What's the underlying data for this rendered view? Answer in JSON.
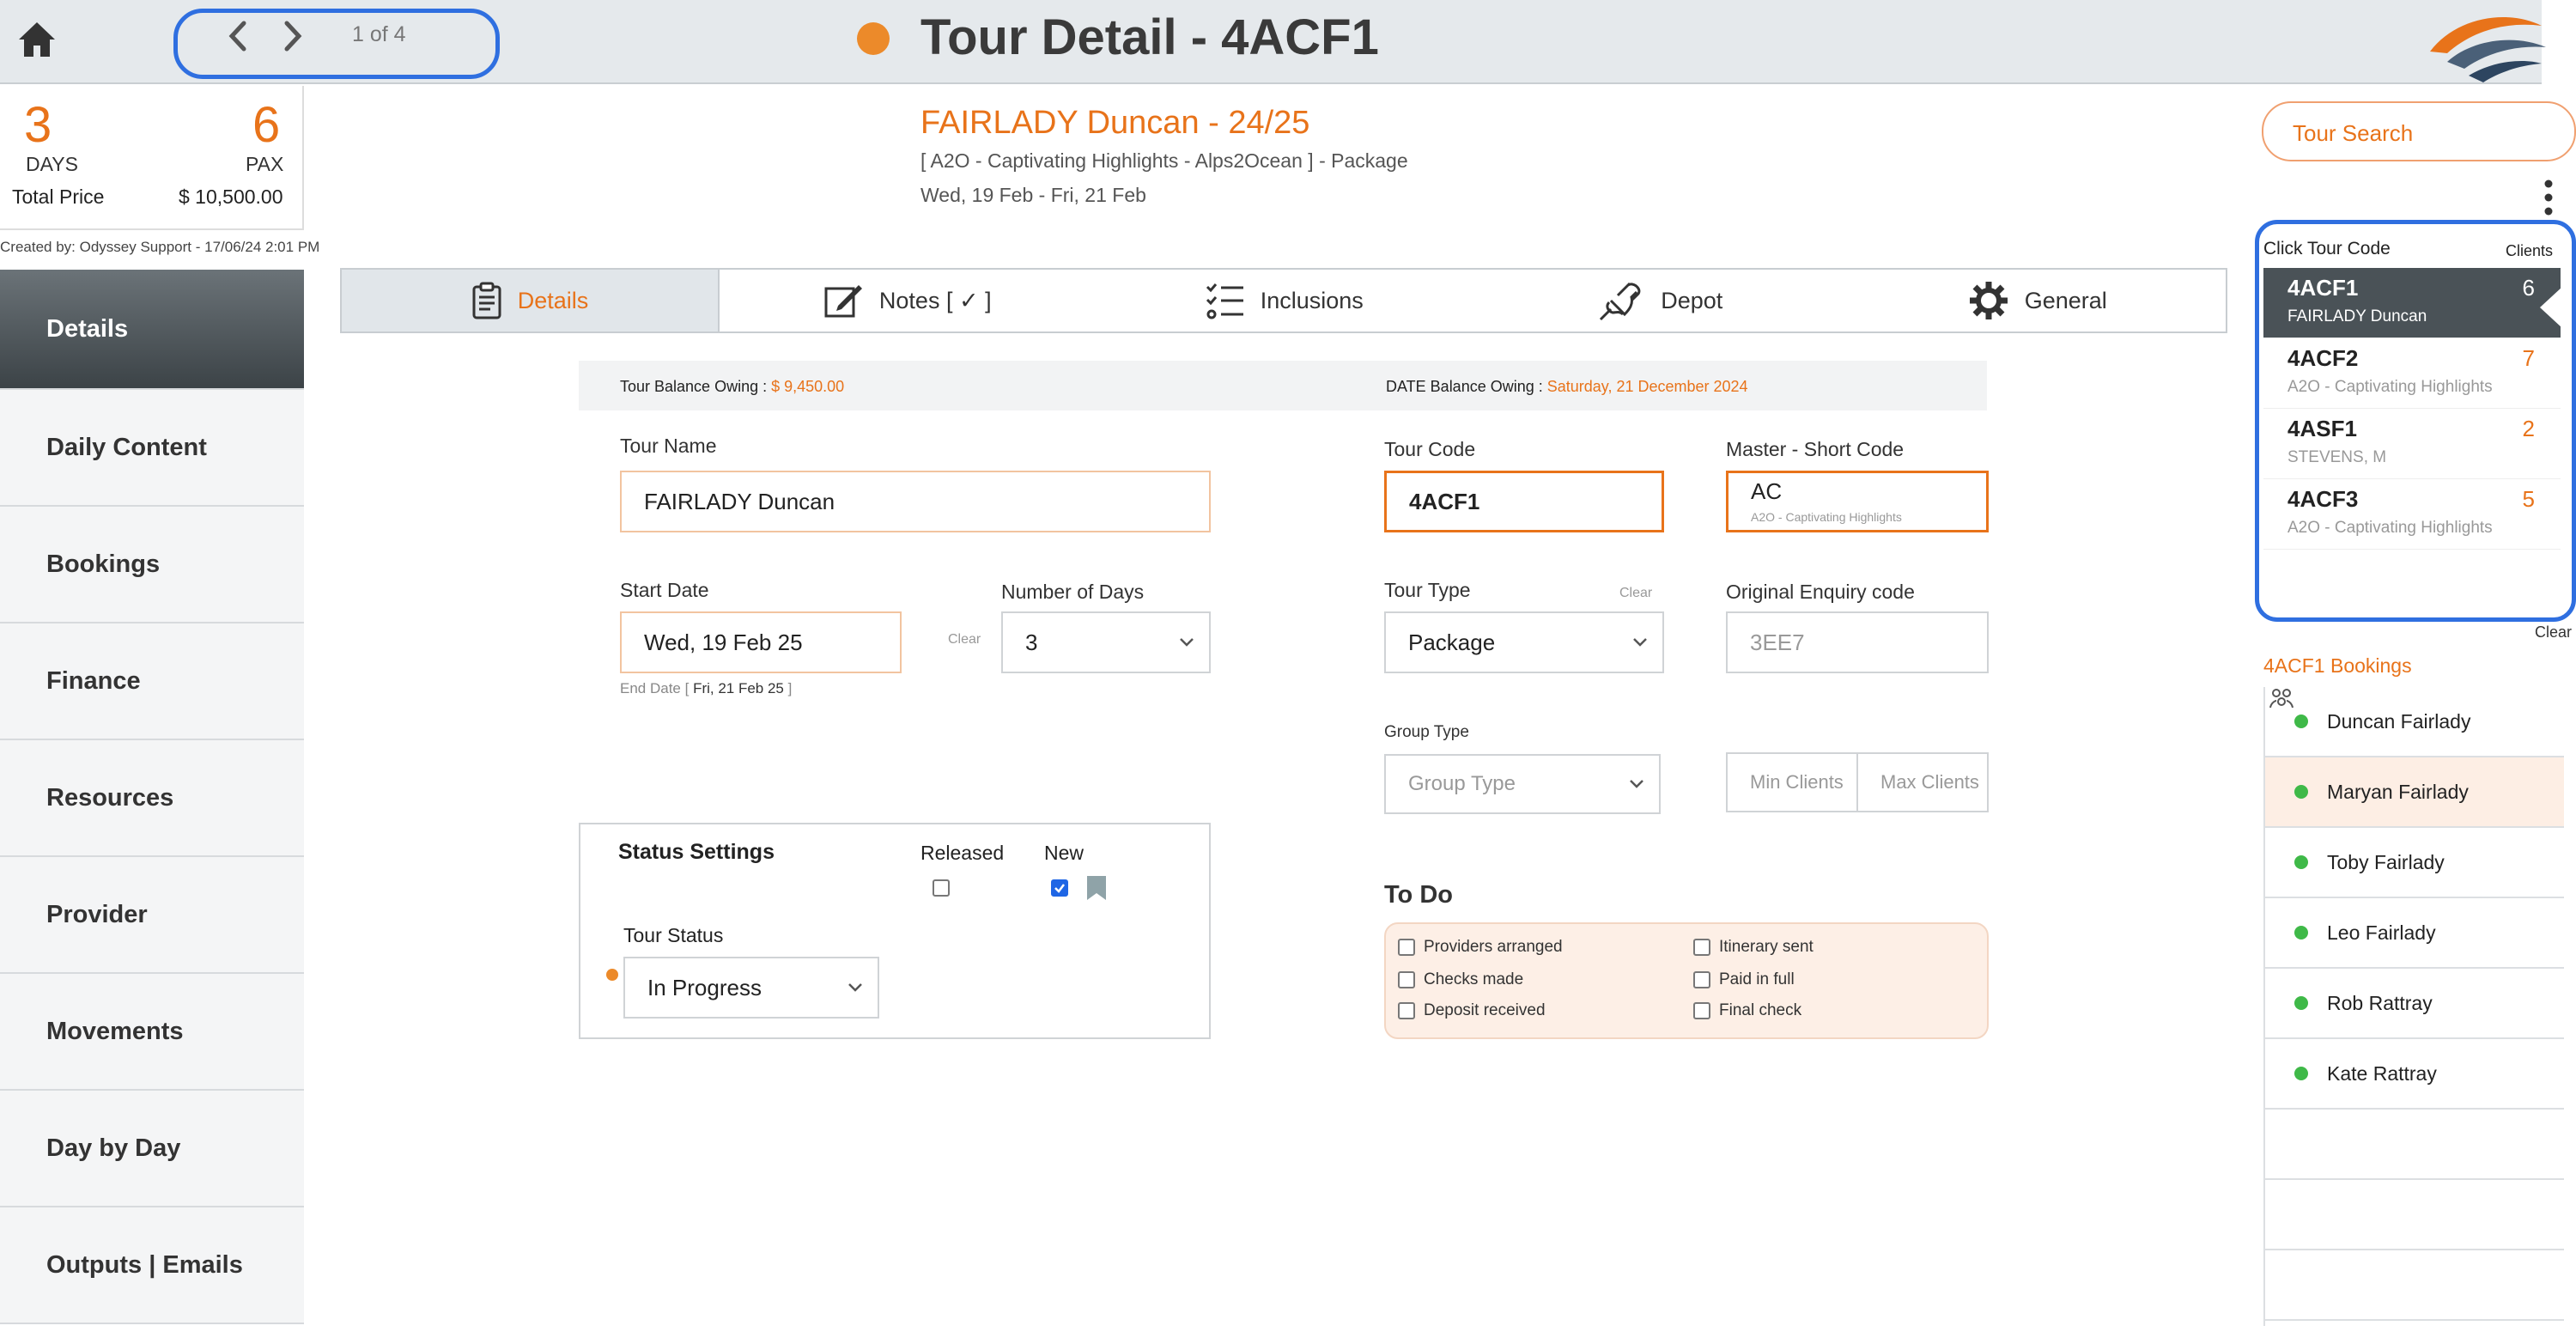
{
  "header": {
    "pager": "1 of 4",
    "title": "Tour Detail - 4ACF1",
    "status_color": "#ec8a2a"
  },
  "summary": {
    "days": "3",
    "days_label": "DAYS",
    "pax": "6",
    "pax_label": "PAX",
    "total_label": "Total Price",
    "total_value": "$ 10,500.00",
    "created": "Created by: Odyssey Support - 17/06/24 2:01 PM"
  },
  "tour": {
    "title": "FAIRLADY Duncan - 24/25",
    "subtitle": "[ A2O - Captivating Highlights - Alps2Ocean ] - Package",
    "dates": "Wed, 19 Feb  - Fri, 21 Feb"
  },
  "sidebar": {
    "items": [
      {
        "label": "Details"
      },
      {
        "label": "Daily Content"
      },
      {
        "label": "Bookings"
      },
      {
        "label": "Finance"
      },
      {
        "label": "Resources"
      },
      {
        "label": "Provider"
      },
      {
        "label": "Movements"
      },
      {
        "label": "Day by Day"
      },
      {
        "label": "Outputs | Emails"
      }
    ]
  },
  "tabs": [
    {
      "label": "Details",
      "icon": "clipboard-icon"
    },
    {
      "label": "Notes [ ✓ ]",
      "icon": "notepad-edit-icon"
    },
    {
      "label": "Inclusions",
      "icon": "checklist-icon"
    },
    {
      "label": "Depot",
      "icon": "plug-icon"
    },
    {
      "label": "General",
      "icon": "gear-icon"
    }
  ],
  "balance": {
    "tour_label": "Tour Balance Owing : ",
    "tour_value": "$ 9,450.00",
    "date_label": "DATE Balance Owing : ",
    "date_value": "Saturday, 21 December 2024"
  },
  "form": {
    "tour_name_label": "Tour Name",
    "tour_name": "FAIRLADY Duncan",
    "start_date_label": "Start Date",
    "start_date": "Wed, 19 Feb 25",
    "start_clear": "Clear",
    "end_date_prefix": "End Date [ ",
    "end_date": "Fri, 21 Feb 25",
    "end_date_suffix": " ]",
    "num_days_label": "Number of Days",
    "num_days": "3",
    "tour_code_label": "Tour Code",
    "tour_code": "4ACF1",
    "master_label": "Master - Short Code",
    "master_code": "AC",
    "master_sub": "A2O - Captivating Highlights",
    "tour_type_label": "Tour Type",
    "tour_type_clear": "Clear",
    "tour_type": "Package",
    "enquiry_label": "Original Enquiry code",
    "enquiry_code": "3EE7",
    "group_type_label": "Group Type",
    "group_type_placeholder": "Group Type",
    "min_clients": "Min Clients",
    "max_clients": "Max Clients"
  },
  "status": {
    "title": "Status Settings",
    "released_label": "Released",
    "new_label": "New",
    "released_checked": false,
    "new_checked": true,
    "tour_status_label": "Tour Status",
    "tour_status": "In Progress"
  },
  "todo": {
    "title": "To Do",
    "items": [
      {
        "label": "Providers arranged"
      },
      {
        "label": "Checks made"
      },
      {
        "label": "Deposit received"
      },
      {
        "label": "Itinerary sent"
      },
      {
        "label": "Paid in full"
      },
      {
        "label": "Final check"
      }
    ]
  },
  "right": {
    "search_label": "Tour Search",
    "click_label": "Click Tour Code",
    "clients_label": "Clients",
    "tour_codes": [
      {
        "code": "4ACF1",
        "sub": "FAIRLADY Duncan",
        "clients": "6"
      },
      {
        "code": "4ACF2",
        "sub": "A2O - Captivating Highlights",
        "clients": "7"
      },
      {
        "code": "4ASF1",
        "sub": "STEVENS, M",
        "clients": "2"
      },
      {
        "code": "4ACF3",
        "sub": "A2O - Captivating Highlights",
        "clients": "5"
      }
    ],
    "clear_label": "Clear",
    "bookings_label": "4ACF1 Bookings",
    "bookings": [
      {
        "name": "Duncan Fairlady"
      },
      {
        "name": "Maryan Fairlady"
      },
      {
        "name": "Toby Fairlady"
      },
      {
        "name": "Leo Fairlady"
      },
      {
        "name": "Rob Rattray"
      },
      {
        "name": "Kate Rattray"
      }
    ]
  },
  "colors": {
    "accent": "#e8731a",
    "highlight_border": "#2f6fe0",
    "booking_dot": "#3fb948"
  }
}
